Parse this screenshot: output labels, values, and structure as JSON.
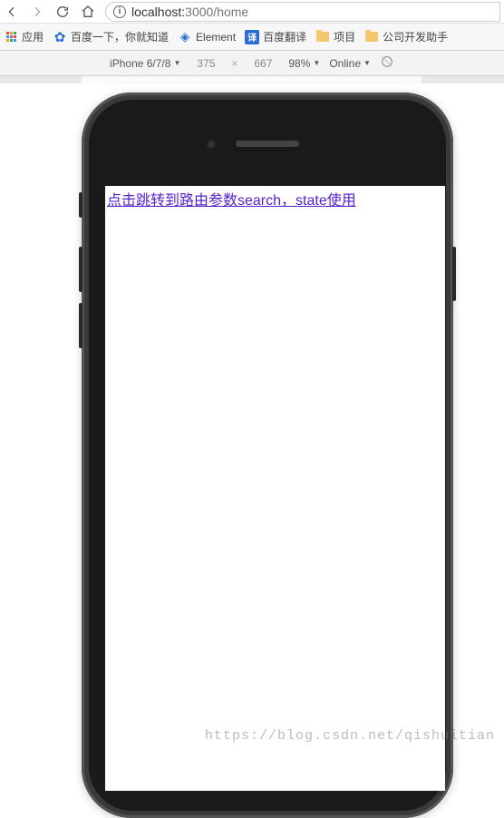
{
  "nav": {
    "url_host": "localhost:",
    "url_port_path": "3000/home"
  },
  "bookmarks": {
    "apps": "应用",
    "baidu": "百度一下，你就知道",
    "element": "Element",
    "baidu_translate": "百度翻译",
    "project": "项目",
    "company_dev": "公司开发助手"
  },
  "devbar": {
    "device": "iPhone 6/7/8",
    "width": "375",
    "height": "667",
    "zoom": "98%",
    "network": "Online"
  },
  "page": {
    "link_text": "点击跳转到路由参数search，state使用"
  },
  "watermark": "https://blog.csdn.net/qishuitian"
}
